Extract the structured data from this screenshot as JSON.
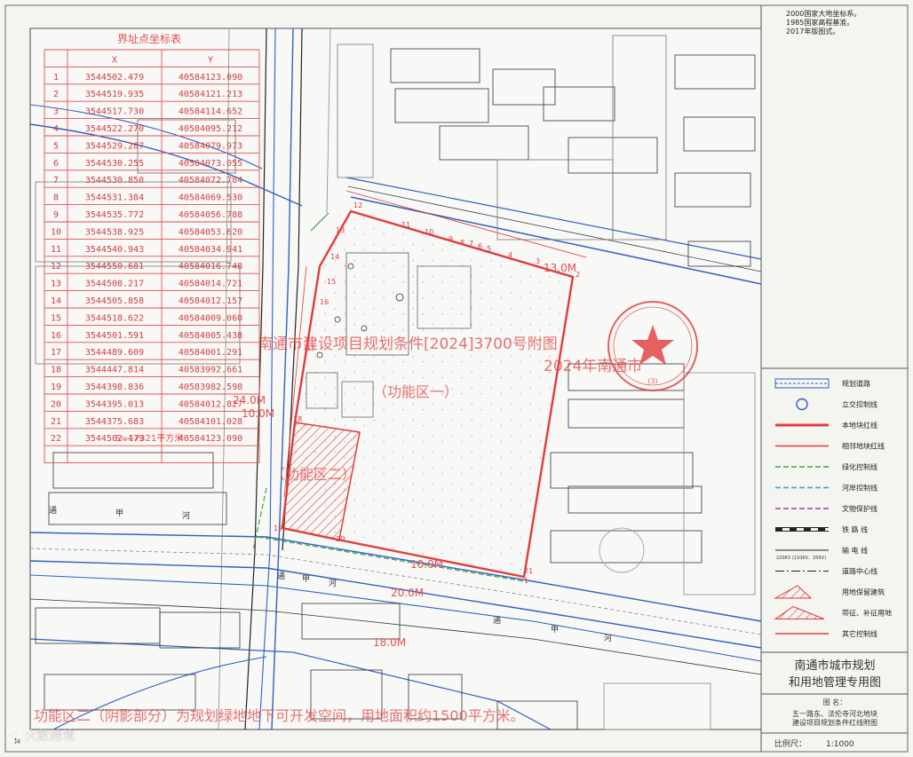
{
  "header_notes": [
    "2000国家大地坐标系。",
    "1985国家高程基准。",
    "2017年版图式。"
  ],
  "coord_table": {
    "title": "界址点坐标表",
    "col_x": "X",
    "col_y": "Y",
    "rows": [
      [
        "1",
        "3544502.479",
        "40584123.090"
      ],
      [
        "2",
        "3544519.935",
        "40584121.213"
      ],
      [
        "3",
        "3544517.730",
        "40584114.652"
      ],
      [
        "4",
        "3544522.270",
        "40584095.212"
      ],
      [
        "5",
        "3544529.287",
        "40584079.973"
      ],
      [
        "6",
        "3544530.255",
        "40584073.055"
      ],
      [
        "7",
        "3544530.850",
        "40584072.784"
      ],
      [
        "8",
        "3544531.384",
        "40584069.530"
      ],
      [
        "9",
        "3544535.772",
        "40584056.788"
      ],
      [
        "10",
        "3544538.925",
        "40584053.620"
      ],
      [
        "11",
        "3544540.943",
        "40584034.941"
      ],
      [
        "12",
        "3544550.681",
        "40584016.748"
      ],
      [
        "13",
        "3544508.217",
        "40584014.721"
      ],
      [
        "14",
        "3544505.858",
        "40584012.157"
      ],
      [
        "15",
        "3544518.622",
        "40584009.060"
      ],
      [
        "16",
        "3544501.591",
        "40584005.438"
      ],
      [
        "17",
        "3544489.609",
        "40584001.291"
      ],
      [
        "18",
        "3544447.814",
        "40583992.661"
      ],
      [
        "19",
        "3544398.836",
        "40583982.598"
      ],
      [
        "20",
        "3544395.013",
        "40584012.827"
      ],
      [
        "21",
        "3544375.683",
        "40584101.028"
      ],
      [
        "22",
        "3544502.479",
        "40584123.090"
      ]
    ],
    "area": "S=17321平方米"
  },
  "overlay": {
    "title_line1": "南通市建设项目规划条件[2024]3700号附图",
    "title_line2": "2024年南通市",
    "zone_one": "（功能区一）",
    "zone_two": "（功能区二）",
    "bottom_note": "功能区二（阴影部分）为规划绿地地下可开发空间，用地面积约1500平方米。",
    "stamp_num": "(3)",
    "watermark": "大数跨境"
  },
  "setbacks": [
    "13.0M",
    "24.0M",
    "10.0M",
    "10.0M",
    "20.0M",
    "18.0M"
  ],
  "point_labels": [
    "1",
    "2",
    "3",
    "4",
    "5",
    "6",
    "7",
    "8",
    "9",
    "10",
    "11",
    "12",
    "13",
    "14",
    "15",
    "16",
    "17",
    "18",
    "19",
    "20",
    "21"
  ],
  "roads": [
    "通",
    "甲",
    "河",
    "通",
    "甲",
    "河",
    "通",
    "甲",
    "河"
  ],
  "legend": {
    "items": [
      {
        "label": "规划道路",
        "type": "road"
      },
      {
        "label": "立交控制线",
        "type": "circle"
      },
      {
        "label": "本地块红线",
        "type": "red-thick"
      },
      {
        "label": "相邻地块红线",
        "type": "red-thin"
      },
      {
        "label": "绿化控制线",
        "type": "green"
      },
      {
        "label": "河岸控制线",
        "type": "cyan"
      },
      {
        "label": "文物保护线",
        "type": "purple"
      },
      {
        "label": "铁 路 线",
        "type": "rail"
      },
      {
        "label": "输 电 线",
        "type": "power",
        "sub": "220KV (110KV、35KV)"
      },
      {
        "label": "道路中心线",
        "type": "center"
      },
      {
        "label": "用地保留建筑",
        "type": "hatch"
      },
      {
        "label": "带征、补征用地",
        "type": "hatch2"
      },
      {
        "label": "其它控制线",
        "type": "other"
      }
    ]
  },
  "title_block": {
    "org": [
      "南通市城市规划",
      "和用地管理专用图"
    ],
    "map_name_label": "图 名：",
    "map_name": [
      "五一路东、法伦寺河北地块",
      "建设项目规划条件红线附图"
    ],
    "scale_label": "比例尺：",
    "scale": "1:1000"
  },
  "corner_mark": "M",
  "colors": {
    "red": "#e03c3c",
    "blue": "#3060c0",
    "green": "#40a040",
    "paper": "#f4f4f1"
  }
}
